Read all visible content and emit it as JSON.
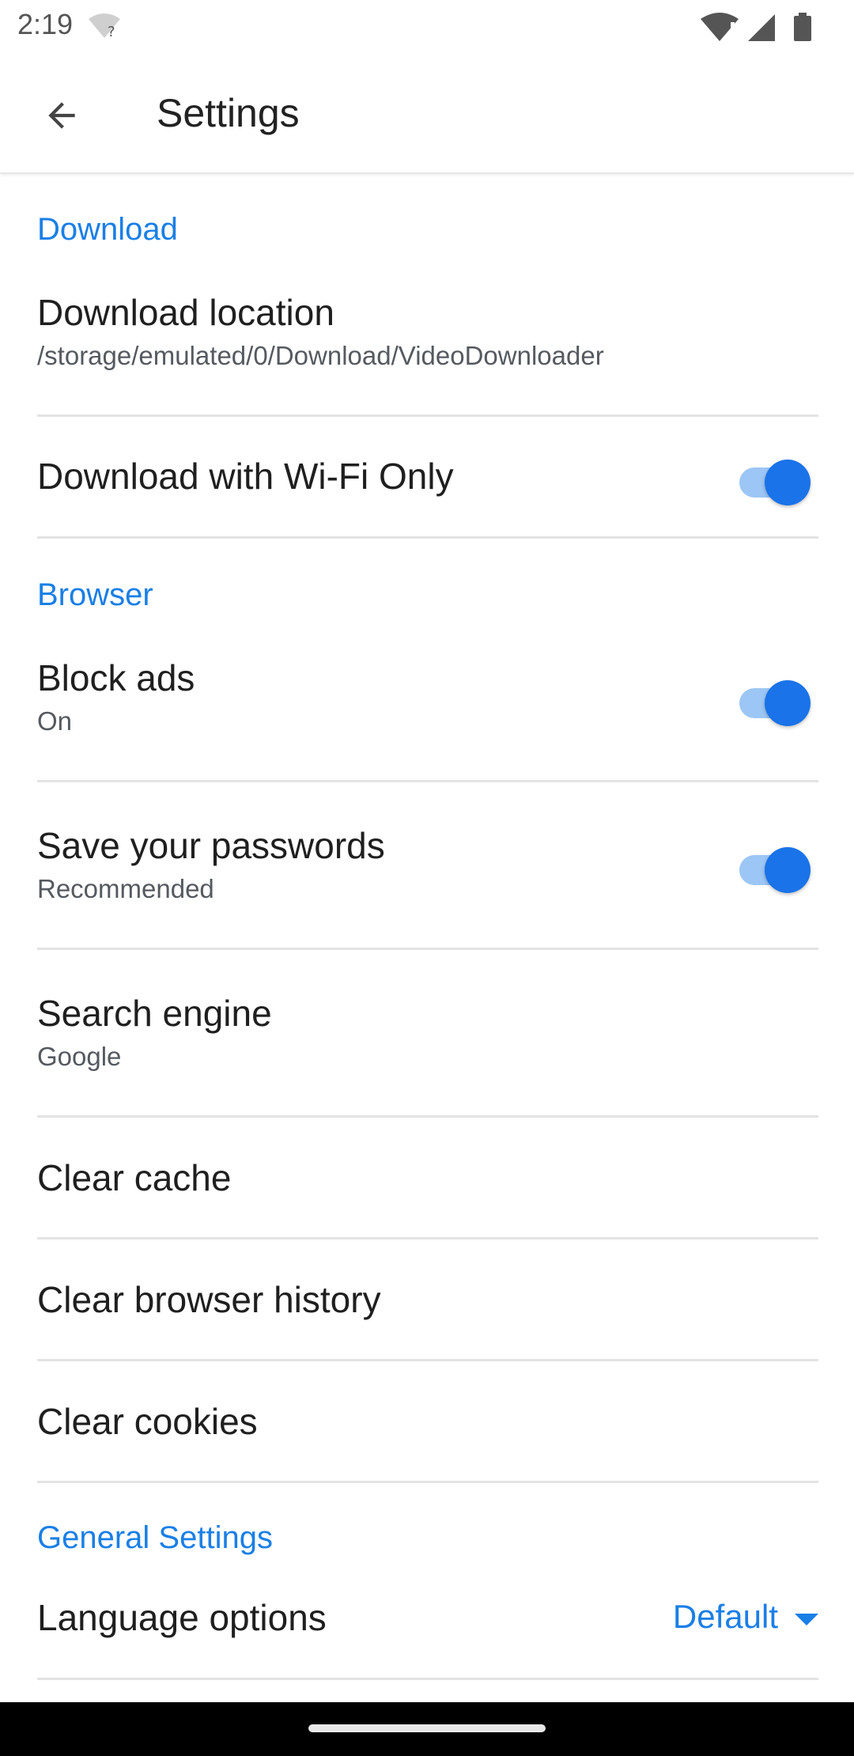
{
  "status_bar": {
    "time": "2:19",
    "icons": [
      "wifi-question-icon",
      "wifi-alert-icon",
      "cell-signal-icon",
      "battery-icon"
    ]
  },
  "app_bar": {
    "title": "Settings",
    "back_icon": "arrow-back-icon"
  },
  "sections": {
    "download": {
      "header": "Download",
      "location_title": "Download location",
      "location_value": "/storage/emulated/0/Download/VideoDownloader",
      "wifi_only_title": "Download with Wi-Fi Only",
      "wifi_only_enabled": true
    },
    "browser": {
      "header": "Browser",
      "block_ads_title": "Block ads",
      "block_ads_sub": "On",
      "block_ads_enabled": true,
      "save_passwords_title": "Save your passwords",
      "save_passwords_sub": "Recommended",
      "save_passwords_enabled": true,
      "search_engine_title": "Search engine",
      "search_engine_value": "Google",
      "clear_cache": "Clear cache",
      "clear_history": "Clear browser history",
      "clear_cookies": "Clear cookies"
    },
    "general": {
      "header": "General Settings",
      "language_title": "Language options",
      "language_value": "Default"
    }
  },
  "colors": {
    "accent": "#1a7fe6",
    "toggle_on": "#1a73e8",
    "toggle_track": "#9cc6f5",
    "divider": "#e3e3e3"
  }
}
